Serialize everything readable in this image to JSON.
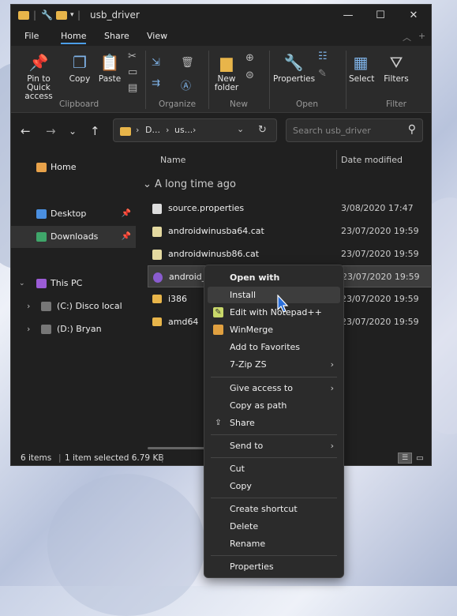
{
  "titlebar": {
    "title": "usb_driver",
    "minimize": "—",
    "maximize": "☐",
    "close": "✕"
  },
  "menubar": {
    "items": [
      "File",
      "Home",
      "Share",
      "View"
    ]
  },
  "ribbon": {
    "pin_label": "Pin to Quick access",
    "copy_label": "Copy",
    "paste_label": "Paste",
    "new_folder_label": "New folder",
    "properties_label": "Properties",
    "select_label": "Select",
    "filters_label": "Filters",
    "groups": [
      "Clipboard",
      "Organize",
      "New",
      "Open",
      "Filter"
    ]
  },
  "address": {
    "path_part1": "D...",
    "path_part2": "us...",
    "search_placeholder": "Search usb_driver"
  },
  "navpane": {
    "items": [
      "Home",
      "Desktop",
      "Downloads",
      "This PC",
      "(C:) Disco local",
      "(D:) Bryan"
    ]
  },
  "content": {
    "col_name": "Name",
    "col_date": "Date modified",
    "group": "A long time ago",
    "rows": [
      {
        "name": "source.properties",
        "date": "3/08/2020 17:47"
      },
      {
        "name": "androidwinusba64.cat",
        "date": "23/07/2020 19:59"
      },
      {
        "name": "androidwinusb86.cat",
        "date": "23/07/2020 19:59"
      },
      {
        "name": "android_w",
        "date": "23/07/2020 19:59"
      },
      {
        "name": "i386",
        "date": "23/07/2020 19:59"
      },
      {
        "name": "amd64",
        "date": "23/07/2020 19:59"
      }
    ]
  },
  "status": {
    "items": "6 items",
    "selected": "1 item selected  6.79 KB",
    "sep": "|"
  },
  "context_menu": {
    "items": [
      "Open with",
      "Install",
      "Edit with Notepad++",
      "WinMerge",
      "Add to Favorites",
      "7-Zip ZS",
      "Give access to",
      "Copy as path",
      "Share",
      "Send to",
      "Cut",
      "Copy",
      "Create shortcut",
      "Delete",
      "Rename",
      "Properties"
    ]
  },
  "colors": {
    "accent": "#4c9ee8",
    "folder": "#e8b54a"
  }
}
